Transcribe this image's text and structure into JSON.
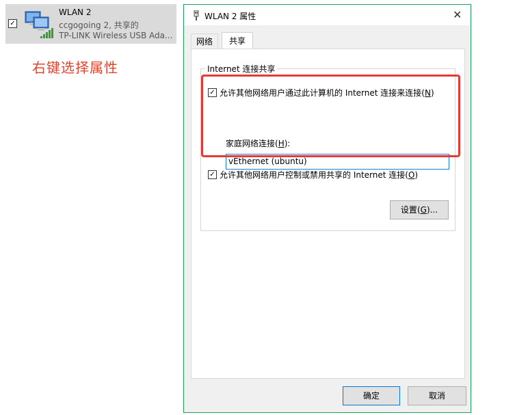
{
  "adapter": {
    "name": "WLAN 2",
    "network": "ccgogoing 2, 共享的",
    "device": "TP-LINK Wireless USB Ada..."
  },
  "hint_text": "右键选择属性",
  "dialog": {
    "title": "WLAN 2 属性",
    "tabs": [
      {
        "label": "网络"
      },
      {
        "label": "共享"
      }
    ],
    "group_label": "Internet 连接共享",
    "allow_share": {
      "label": "允许其他网络用户通过此计算机的 Internet 连接来连接",
      "mnemonic": "N",
      "checked": true
    },
    "home_conn": {
      "label": "家庭网络连接",
      "mnemonic": "H",
      "value": "vEthernet (ubuntu)"
    },
    "allow_control": {
      "label": "允许其他网络用户控制或禁用共享的 Internet 连接",
      "mnemonic": "O",
      "checked": true
    },
    "settings_button": {
      "label": "设置",
      "mnemonic": "G"
    },
    "ok_button": "确定",
    "cancel_button": "取消"
  },
  "colors": {
    "hint": "#e8412c",
    "highlight_box": "#e53935",
    "dialog_border": "#18a05a",
    "focus": "#1b7fd0"
  },
  "icons": {
    "adapter_icon": "network-adapter-icon",
    "signal_icon": "wifi-signal-icon",
    "title_icon": "adapter-plug-icon",
    "close_icon": "close-icon"
  }
}
